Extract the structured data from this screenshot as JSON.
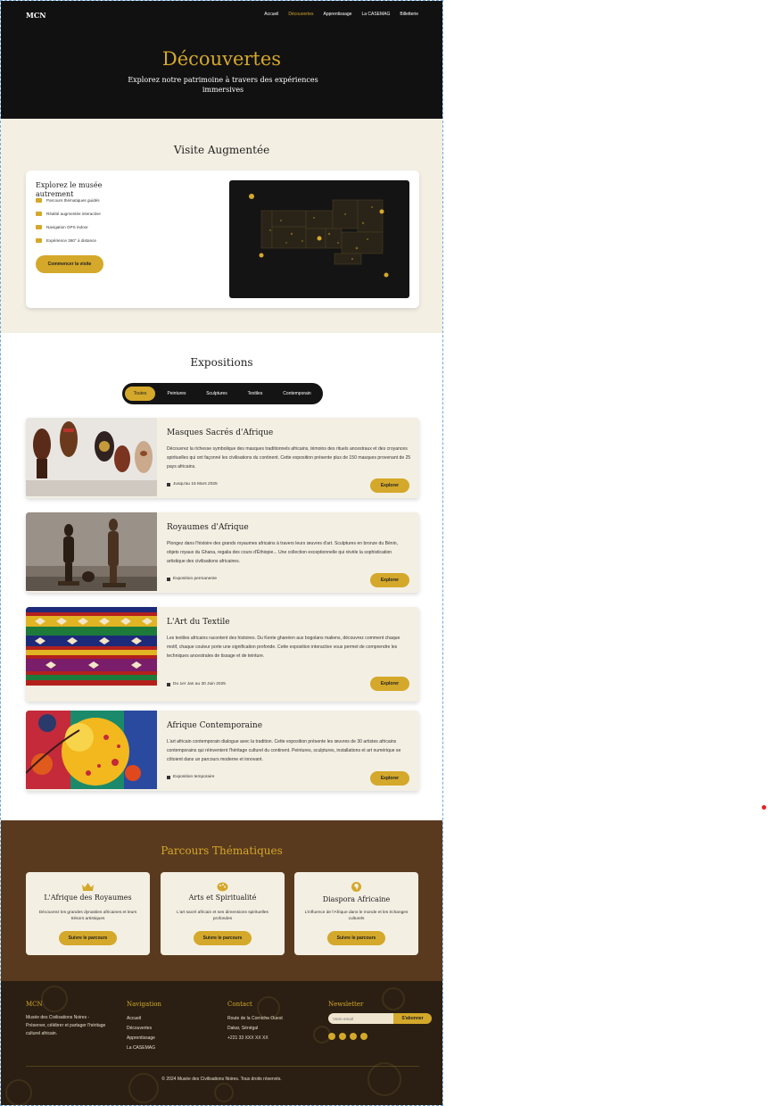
{
  "header": {
    "logo": "MCN",
    "nav": [
      "Accueil",
      "Découvertes",
      "Apprentissage",
      "La CASEMAG",
      "Billetterie"
    ],
    "active": "Découvertes"
  },
  "hero": {
    "title": "Découvertes",
    "subtitle": "Explorez notre patrimoine à travers des expériences immersives"
  },
  "visite": {
    "title": "Visite Augmentée",
    "card_title": "Explorez le musée autrement",
    "features": [
      {
        "icon": "route-icon",
        "label": "Parcours thématiques guidés"
      },
      {
        "icon": "camera-icon",
        "label": "Réalité augmentée interactive"
      },
      {
        "icon": "map-icon",
        "label": "Navigation GPS indoor"
      },
      {
        "icon": "vr-headset-icon",
        "label": "Expérience 360° à distance"
      }
    ],
    "cta": "Commencer la visite"
  },
  "expositions": {
    "title": "Expositions",
    "filters": [
      "Toutes",
      "Peintures",
      "Sculptures",
      "Textiles",
      "Contemporain"
    ],
    "active_filter": "Toutes",
    "items": [
      {
        "title": "Masques Sacrés d'Afrique",
        "description": "Découvrez la richesse symbolique des masques traditionnels africains, témoins des rituels ancestraux et des croyances spirituelles qui ont façonné les civilisations du continent. Cette exposition présente plus de 150 masques provenant de 25 pays africains.",
        "date": "Jusqu'au 15 Mars 2025",
        "button": "Explorer"
      },
      {
        "title": "Royaumes d'Afrique",
        "description": "Plongez dans l'histoire des grands royaumes africains à travers leurs œuvres d'art. Sculptures en bronze du Bénin, objets royaux du Ghana, regalia des cours d'Éthiopie... Une collection exceptionnelle qui révèle la sophistication artistique des civilisations africaines.",
        "date": "Exposition permanente",
        "button": "Explorer"
      },
      {
        "title": "L'Art du Textile",
        "description": "Les textiles africains racontent des histoires. Du Kente ghanéen aux bogolans maliens, découvrez comment chaque motif, chaque couleur porte une signification profonde. Cette exposition interactive vous permet de comprendre les techniques ancestrales de tissage et de teinture.",
        "date": "Du 1er Jan au 30 Juin 2025",
        "button": "Explorer"
      },
      {
        "title": "Afrique Contemporaine",
        "description": "L'art africain contemporain dialogue avec la tradition. Cette exposition présente les œuvres de 30 artistes africains contemporains qui réinventent l'héritage culturel du continent. Peintures, sculptures, installations et art numérique se côtoient dans un parcours moderne et innovant.",
        "date": "Exposition temporaire",
        "button": "Explorer"
      }
    ]
  },
  "parcours": {
    "title": "Parcours Thématiques",
    "items": [
      {
        "icon": "crown-icon",
        "title": "L'Afrique des Royaumes",
        "description": "Découvrez les grandes dynasties africaines et leurs trésors artistiques",
        "button": "Suivre le parcours"
      },
      {
        "icon": "palette-icon",
        "title": "Arts et Spiritualité",
        "description": "L'art sacré africain et ses dimensions spirituelles profondes",
        "button": "Suivre le parcours"
      },
      {
        "icon": "globe-africa-icon",
        "title": "Diaspora Africaine",
        "description": "L'influence de l'Afrique dans le monde et les échanges culturels",
        "button": "Suivre le parcours"
      }
    ]
  },
  "footer": {
    "brand": "MCN",
    "about": "Musée des Civilisations Noires - Préserver, célébrer et partager l'héritage culturel africain.",
    "nav_title": "Navigation",
    "nav": [
      "Accueil",
      "Découvertes",
      "Apprentissage",
      "La CASEMAG"
    ],
    "contact_title": "Contact",
    "contact": [
      "Route de la Corniche Ouest",
      "Dakar, Sénégal",
      "+221 33 XXX XX XX"
    ],
    "newsletter_title": "Newsletter",
    "email_placeholder": "Votre email",
    "subscribe": "S'abonner",
    "socials": [
      "facebook-icon",
      "instagram-icon",
      "twitter-icon",
      "youtube-icon"
    ],
    "copyright": "© 2024 Musée des Civilisations Noires. Tous droits réservés."
  },
  "colors": {
    "gold": "#d4a82a",
    "dark": "#111111",
    "cream": "#f4efe3",
    "brown": "#5a3a1e"
  }
}
